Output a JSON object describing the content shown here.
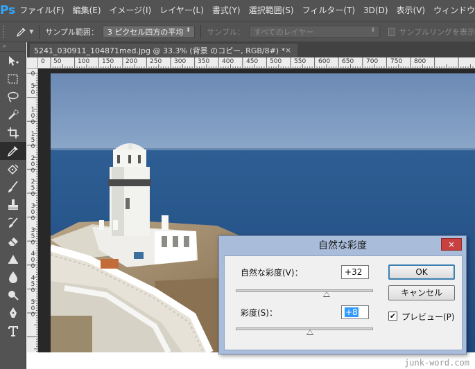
{
  "app": {
    "logo_text": "Ps",
    "menu": [
      "ファイル(F)",
      "編集(E)",
      "イメージ(I)",
      "レイヤー(L)",
      "書式(Y)",
      "選択範囲(S)",
      "フィルター(T)",
      "3D(D)",
      "表示(V)",
      "ウィンドウ(W)"
    ]
  },
  "options_bar": {
    "tool_icon": "eyedropper-icon",
    "sample_size_label": "サンプル範囲：",
    "sample_size_value": "3 ピクセル四方の平均",
    "sample_label": "サンプル：",
    "sample_value": "すべてのレイヤー",
    "show_ring_label": "サンプルリングを表示"
  },
  "document": {
    "tab_title": "5241_030911_104871med.jpg @ 33.3% (背景 のコピー, RGB/8#) *",
    "tab_close": "×"
  },
  "rulers": {
    "horizontal": [
      "0",
      "50",
      "100",
      "150",
      "200",
      "250",
      "300",
      "350",
      "400",
      "450",
      "500",
      "550",
      "600",
      "650",
      "700",
      "750",
      "800"
    ],
    "vertical": [
      "0",
      "50",
      "100",
      "150",
      "200",
      "250",
      "300",
      "350",
      "400",
      "450",
      "500"
    ]
  },
  "toolbar": {
    "head": "»",
    "tools": [
      "move-icon",
      "marquee-icon",
      "lasso-icon",
      "quick-select-icon",
      "crop-icon",
      "eyedropper-icon",
      "healing-icon",
      "brush-icon",
      "stamp-icon",
      "history-brush-icon",
      "eraser-icon",
      "gradient-icon",
      "blur-icon",
      "dodge-icon",
      "pen-icon",
      "type-icon"
    ],
    "active_tool": "eyedropper-icon"
  },
  "dialog": {
    "title": "自然な彩度",
    "close": "×",
    "vibrance_label": "自然な彩度(V)：",
    "vibrance_value": "+32",
    "vibrance_slider": 32,
    "saturation_label": "彩度(S)：",
    "saturation_value": "+8",
    "saturation_slider": 8,
    "ok_label": "OK",
    "cancel_label": "キャンセル",
    "preview_label": "プレビュー(P)",
    "preview_checked": true
  },
  "watermark": "junk-word.com",
  "colors": {
    "ui_dark": "#535353",
    "dialog_frame": "#a9bcd9",
    "close_red": "#c84040",
    "selection_blue": "#3399ff",
    "logo_blue": "#31a8ff"
  }
}
